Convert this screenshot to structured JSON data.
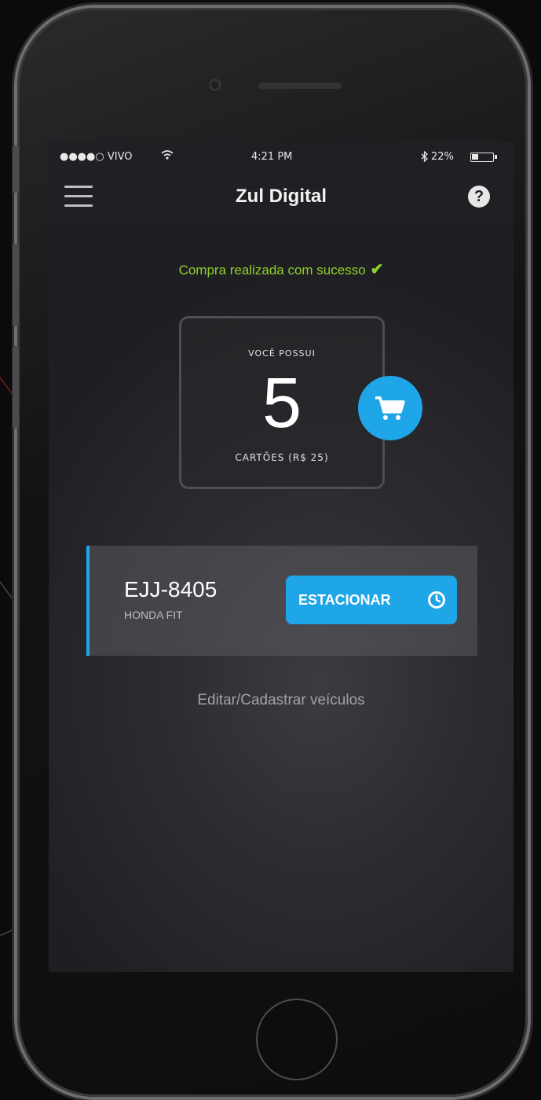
{
  "status_bar": {
    "carrier": "●●●●○ VIVO",
    "time": "4:21 PM",
    "battery": "22%"
  },
  "nav": {
    "title": "Zul Digital",
    "help_label": "?"
  },
  "success_message": "Compra realizada com sucesso",
  "cards": {
    "top_label": "VOCÊ POSSUI",
    "count": "5",
    "bottom_label": "CARTÕES (R$ 25)"
  },
  "vehicle": {
    "plate": "EJJ-8405",
    "model": "HONDA FIT",
    "park_label": "ESTACIONAR"
  },
  "edit_vehicles_label": "Editar/Cadastrar veículos",
  "colors": {
    "accent": "#1fa6e8",
    "success": "#8fd12b"
  },
  "icons": [
    "menu-icon",
    "help-icon",
    "check-icon",
    "cart-icon",
    "clock-icon",
    "wifi-icon",
    "bluetooth-icon",
    "battery-icon"
  ]
}
